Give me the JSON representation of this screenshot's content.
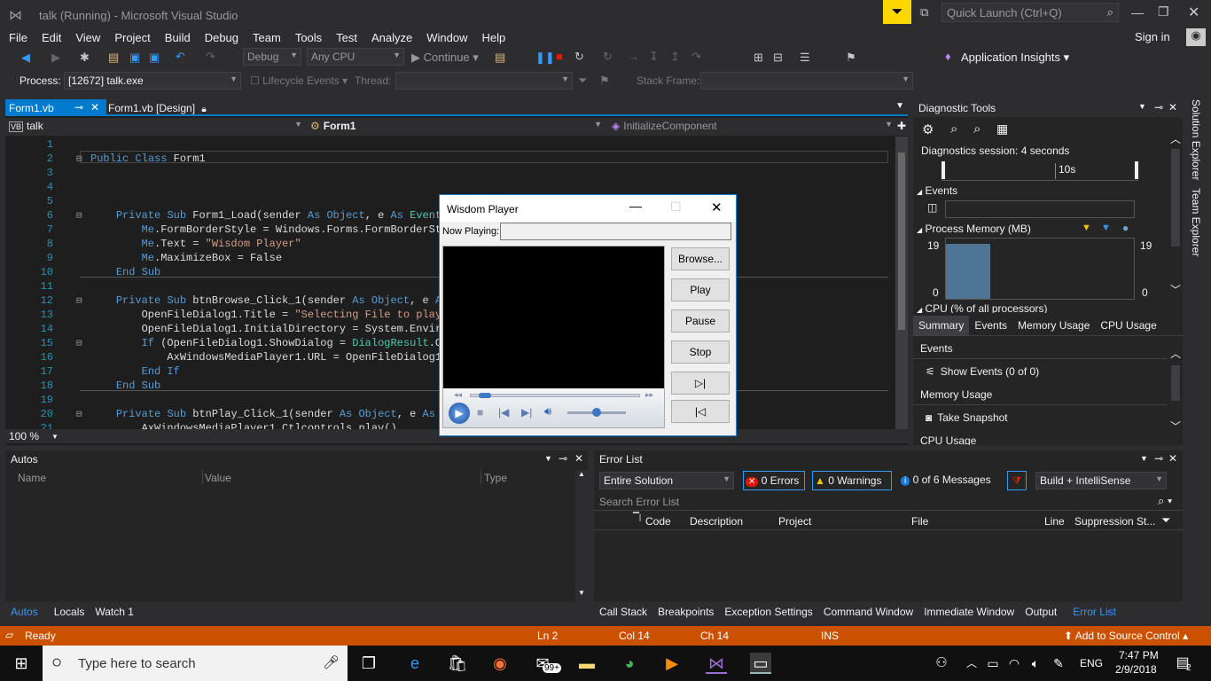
{
  "window": {
    "title": "talk (Running) - Microsoft Visual Studio",
    "quick_launch": "Quick Launch (Ctrl+Q)",
    "sign_in": "Sign in"
  },
  "menu": [
    "File",
    "Edit",
    "View",
    "Project",
    "Build",
    "Debug",
    "Team",
    "Tools",
    "Test",
    "Analyze",
    "Window",
    "Help"
  ],
  "toolbar": {
    "config": "Debug",
    "platform": "Any CPU",
    "continue": "Continue",
    "app_insights": "Application Insights"
  },
  "toolbar2": {
    "process_label": "Process:",
    "process_value": "[12672] talk.exe",
    "lifecycle": "Lifecycle Events",
    "thread_label": "Thread:",
    "stack_label": "Stack Frame:"
  },
  "editor": {
    "tabs": [
      {
        "label": "Form1.vb",
        "active": true
      },
      {
        "label": "Form1.vb [Design]",
        "active": false
      }
    ],
    "nav": {
      "project": "talk",
      "class": "Form1",
      "member": "InitializeComponent"
    },
    "zoom": "100 %",
    "lines": [
      {
        "n": "1",
        "t": ""
      },
      {
        "n": "2",
        "t": "Public Class Form1"
      },
      {
        "n": "3",
        "t": ""
      },
      {
        "n": "4",
        "t": ""
      },
      {
        "n": "5",
        "t": ""
      },
      {
        "n": "6",
        "t": "    Private Sub Form1_Load(sender As Object, e As EventAr"
      },
      {
        "n": "7",
        "t": "        Me.FormBorderStyle = Windows.Forms.FormBorderSty"
      },
      {
        "n": "8",
        "t": "        Me.Text = \"Wisdom Player\""
      },
      {
        "n": "9",
        "t": "        Me.MaximizeBox = False"
      },
      {
        "n": "10",
        "t": "    End Sub"
      },
      {
        "n": "11",
        "t": ""
      },
      {
        "n": "12",
        "t": "    Private Sub btnBrowse_Click_1(sender As Object, e As"
      },
      {
        "n": "13",
        "t": "        OpenFileDialog1.Title = \"Selecting File to play.."
      },
      {
        "n": "14",
        "t": "        OpenFileDialog1.InitialDirectory = System.Enviror"
      },
      {
        "n": "15",
        "t": "        If (OpenFileDialog1.ShowDialog = DialogResult.OK)"
      },
      {
        "n": "16",
        "t": "            AxWindowsMediaPlayer1.URL = OpenFileDialog1.F"
      },
      {
        "n": "17",
        "t": "        End If"
      },
      {
        "n": "18",
        "t": "    End Sub"
      },
      {
        "n": "19",
        "t": ""
      },
      {
        "n": "20",
        "t": "    Private Sub btnPlay_Click_1(sender As Object, e As Ev"
      },
      {
        "n": "21",
        "t": "        AxWindowsMediaPlayer1.Ctlcontrols.play()"
      }
    ]
  },
  "diagnostic": {
    "title": "Diagnostic Tools",
    "session": "Diagnostics session: 4 seconds",
    "timeline_label": "10s",
    "events": "Events",
    "memory": "Process Memory (MB)",
    "mem_max": "19",
    "mem_min": "0",
    "cpu": "CPU (% of all processors)",
    "tabs": [
      "Summary",
      "Events",
      "Memory Usage",
      "CPU Usage"
    ],
    "sec_events": "Events",
    "show_events": "Show Events (0 of 0)",
    "sec_memory": "Memory Usage",
    "take_snapshot": "Take Snapshot",
    "sec_cpu": "CPU Usage"
  },
  "side_tabs": [
    "Solution Explorer",
    "Team Explorer"
  ],
  "autos": {
    "title": "Autos",
    "cols": [
      "Name",
      "Value",
      "Type"
    ],
    "tabs": [
      "Autos",
      "Locals",
      "Watch 1"
    ]
  },
  "errors": {
    "title": "Error List",
    "scope": "Entire Solution",
    "errors": "0 Errors",
    "warnings": "0 Warnings",
    "messages": "0 of 6 Messages",
    "build": "Build + IntelliSense",
    "search": "Search Error List",
    "cols": [
      "Code",
      "Description",
      "Project",
      "File",
      "Line",
      "Suppression St..."
    ],
    "tabs": [
      "Call Stack",
      "Breakpoints",
      "Exception Settings",
      "Command Window",
      "Immediate Window",
      "Output",
      "Error List"
    ]
  },
  "player": {
    "title": "Wisdom Player",
    "now_playing": "Now Playing:",
    "buttons": [
      "Browse...",
      "Play",
      "Pause",
      "Stop",
      "▷|",
      "|◁"
    ],
    "seek_progress": 0.05,
    "volume_level": 0.5
  },
  "status": {
    "ready": "Ready",
    "ln": "Ln 2",
    "col": "Col 14",
    "ch": "Ch 14",
    "ins": "INS",
    "source": "Add to Source Control"
  },
  "taskbar": {
    "search": "Type here to search",
    "lang": "ENG",
    "time": "7:47 PM",
    "date": "2/9/2018",
    "mail_badge": "99+",
    "notif": "2"
  }
}
